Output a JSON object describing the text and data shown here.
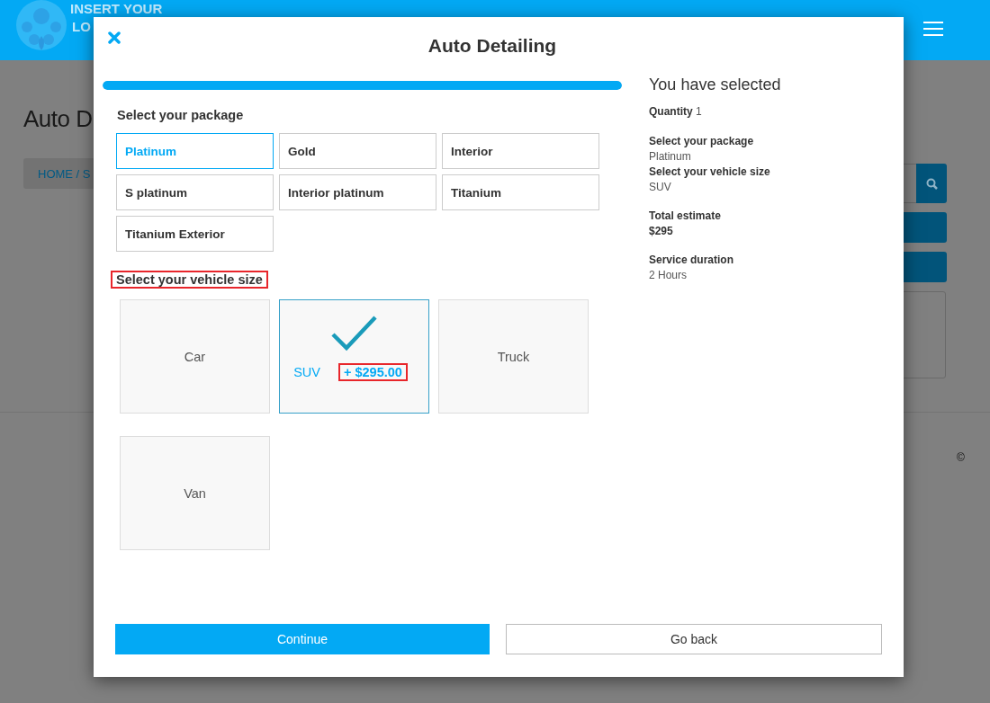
{
  "header": {
    "logo_line_1": "INSERT YOUR",
    "logo_line_2": "LO"
  },
  "page": {
    "heading": "Auto D",
    "breadcrumb": "HOME / S",
    "footer_mark": "©"
  },
  "modal": {
    "title": "Auto Detailing",
    "progress": {
      "level": 1
    },
    "package_heading": "Select your package",
    "packages": [
      {
        "label": "Platinum",
        "selected": true
      },
      {
        "label": "Gold",
        "selected": false
      },
      {
        "label": "Interior",
        "selected": false
      },
      {
        "label": "S platinum",
        "selected": false
      },
      {
        "label": "Interior platinum",
        "selected": false
      },
      {
        "label": "Titanium",
        "selected": false
      },
      {
        "label": "Titanium Exterior",
        "selected": false
      }
    ],
    "vehicle_heading": "Select your vehicle size",
    "vehicles": [
      {
        "label": "Car",
        "selected": false
      },
      {
        "label": "SUV",
        "selected": true,
        "price": "+ $295.00"
      },
      {
        "label": "Truck",
        "selected": false
      },
      {
        "label": "Van",
        "selected": false
      }
    ],
    "summary": {
      "title": "You have selected",
      "quantity_label": "Quantity",
      "quantity_value": "1",
      "groups": [
        [
          {
            "label": "Select your package",
            "value": "Platinum"
          },
          {
            "label": "Select your vehicle size",
            "value": "SUV"
          }
        ],
        [
          {
            "label": "Total estimate",
            "value": "$295",
            "bold": true
          }
        ],
        [
          {
            "label": "Service duration",
            "value": "2 Hours",
            "bold": false
          }
        ]
      ]
    },
    "buttons": [
      {
        "label": "Continue",
        "kind": "primary"
      },
      {
        "label": "Go back",
        "kind": "secondary"
      }
    ]
  }
}
